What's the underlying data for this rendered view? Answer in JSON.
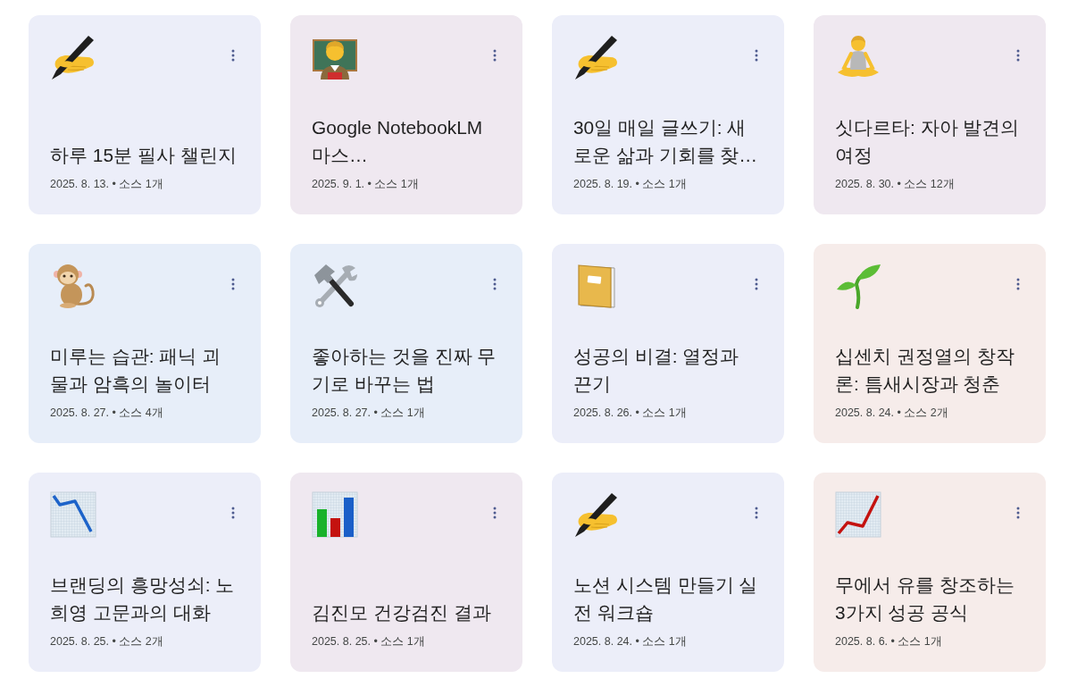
{
  "cards": [
    {
      "kind": "writing",
      "color": "#eceef9",
      "title": "하루 15분 필사 챌린지",
      "meta": "2025. 8. 13. • 소스 1개"
    },
    {
      "kind": "teacher",
      "color": "#efe8f0",
      "title": "Google NotebookLM 마스…",
      "meta": "2025. 9. 1. • 소스 1개"
    },
    {
      "kind": "writing",
      "color": "#eceef9",
      "title": "30일 매일 글쓰기: 새로운 삶과 기회를 찾…",
      "meta": "2025. 8. 19. • 소스 1개"
    },
    {
      "kind": "lotus",
      "color": "#efe8f0",
      "title": "싯다르타: 자아 발견의 여정",
      "meta": "2025. 8. 30. • 소스 12개"
    },
    {
      "kind": "monkey",
      "color": "#e7eef9",
      "title": "미루는 습관: 패닉 괴물과 암흑의 놀이터",
      "meta": "2025. 8. 27. • 소스 4개"
    },
    {
      "kind": "tools",
      "color": "#e7eef9",
      "title": "좋아하는 것을 진짜 무기로 바꾸는 법",
      "meta": "2025. 8. 27. • 소스 1개"
    },
    {
      "kind": "notebook",
      "color": "#eceef9",
      "title": "성공의 비결: 열정과 끈기",
      "meta": "2025. 8. 26. • 소스 1개"
    },
    {
      "kind": "sprout",
      "color": "#f6ecea",
      "title": "십센치 권정열의 창작론: 틈새시장과 청춘",
      "meta": "2025. 8. 24. • 소스 2개"
    },
    {
      "kind": "decline",
      "color": "#eceef9",
      "title": "브랜딩의 흥망성쇠: 노희영 고문과의 대화",
      "meta": "2025. 8. 25. • 소스 2개"
    },
    {
      "kind": "bars",
      "color": "#efe8f0",
      "title": "김진모 건강검진 결과",
      "meta": "2025. 8. 25. • 소스 1개"
    },
    {
      "kind": "writing",
      "color": "#eceef9",
      "title": "노션 시스템 만들기 실전 워크숍",
      "meta": "2025. 8. 24. • 소스 1개"
    },
    {
      "kind": "growth",
      "color": "#f6ecea",
      "title": "무에서 유를 창조하는 3가지 성공 공식",
      "meta": "2025. 8. 6. • 소스 1개"
    }
  ]
}
